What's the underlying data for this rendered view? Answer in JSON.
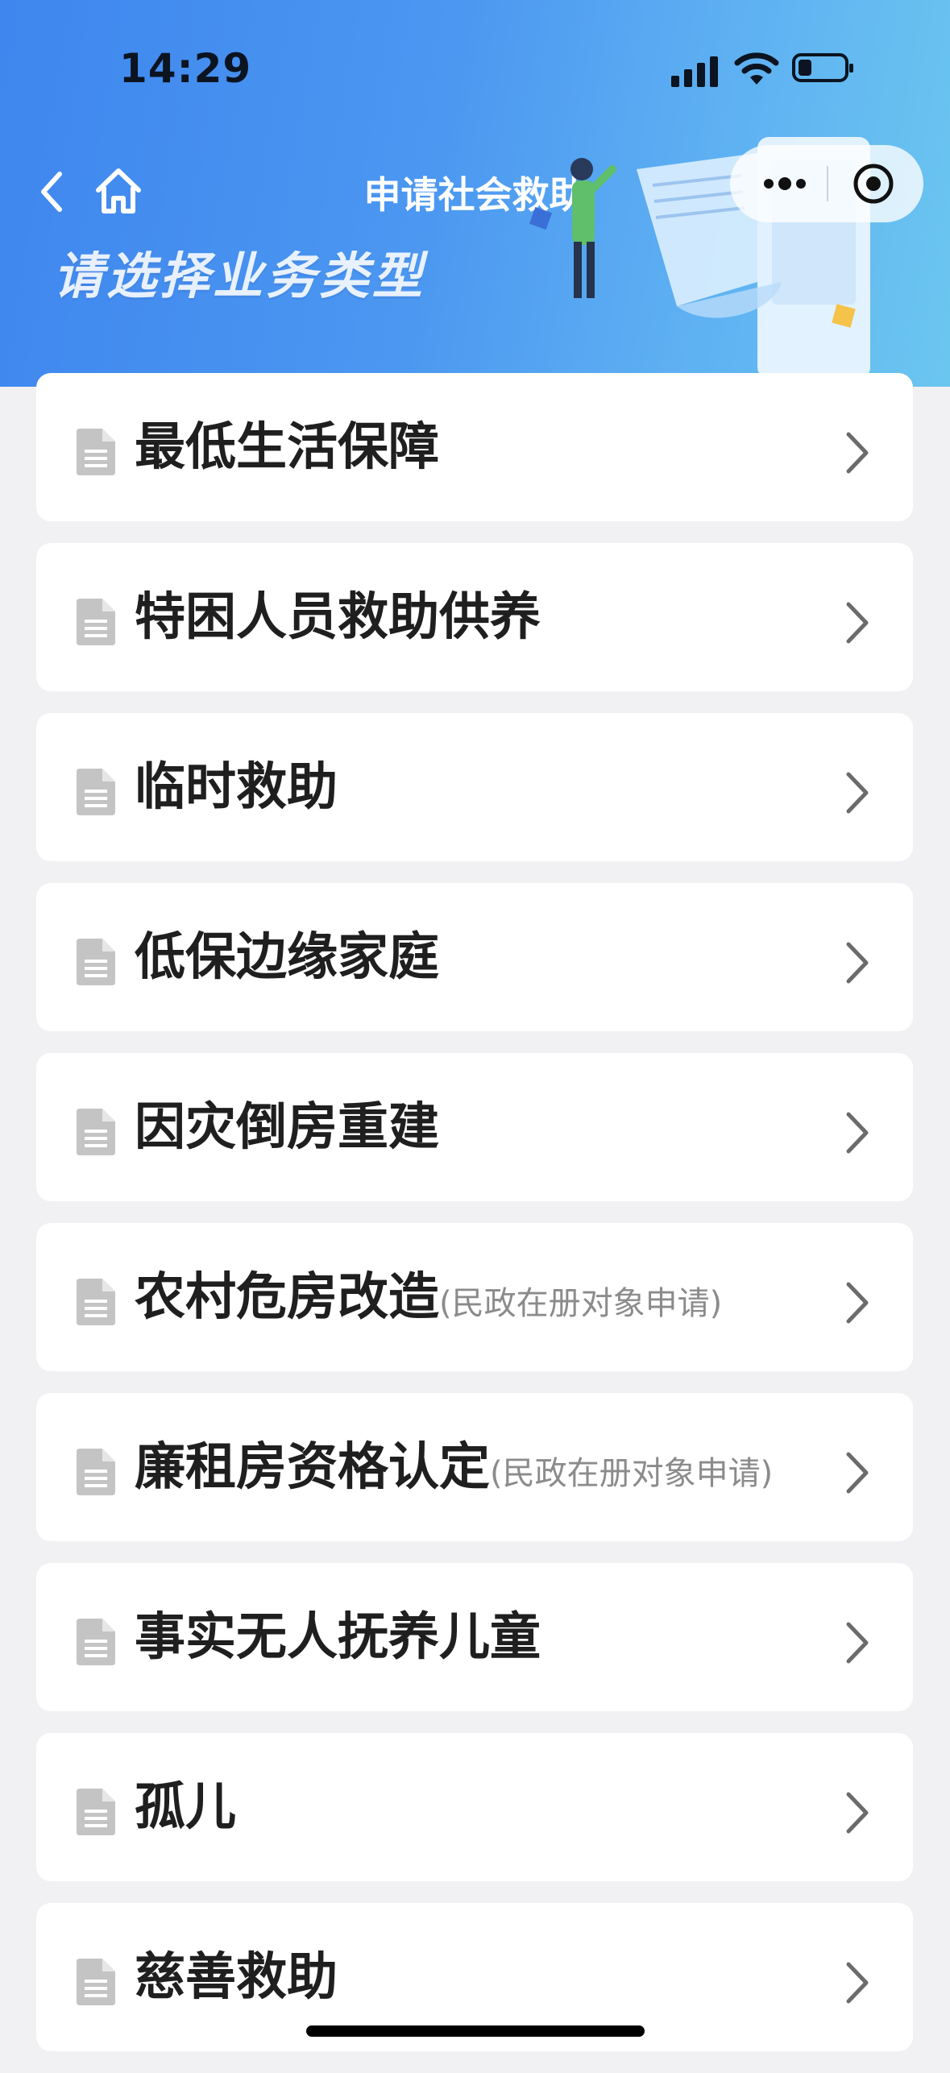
{
  "status_bar": {
    "time": "14:29"
  },
  "nav": {
    "title": "申请社会救助"
  },
  "header": {
    "subtitle": "请选择业务类型"
  },
  "items": [
    {
      "label": "最低生活保障",
      "note": ""
    },
    {
      "label": "特困人员救助供养",
      "note": ""
    },
    {
      "label": "临时救助",
      "note": ""
    },
    {
      "label": "低保边缘家庭",
      "note": ""
    },
    {
      "label": "因灾倒房重建",
      "note": ""
    },
    {
      "label": "农村危房改造",
      "note": "(民政在册对象申请)"
    },
    {
      "label": "廉租房资格认定",
      "note": "(民政在册对象申请)"
    },
    {
      "label": "事实无人抚养儿童",
      "note": ""
    },
    {
      "label": "孤儿",
      "note": ""
    },
    {
      "label": "慈善救助",
      "note": ""
    }
  ],
  "icons": {
    "back": "back-arrow-icon",
    "home": "home-icon",
    "more": "more-dots-icon",
    "close": "target-close-icon",
    "item": "document-icon",
    "chevron": "chevron-right-icon"
  }
}
